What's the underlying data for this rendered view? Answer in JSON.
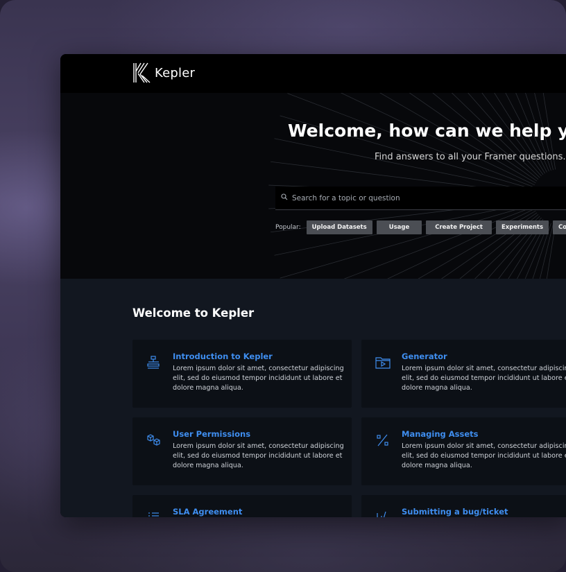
{
  "app": {
    "brand": "Kepler"
  },
  "hero": {
    "title": "Welcome, how can we help you",
    "subtitle": "Find answers to all your Framer questions.",
    "search_placeholder": "Search for a topic or question",
    "popular_label": "Popular:",
    "chips": [
      "Upload Datasets",
      "Usage",
      "Create Project",
      "Experiments",
      "Connect"
    ]
  },
  "main": {
    "section_title": "Welcome to Kepler",
    "cards": [
      {
        "title": "Introduction to Kepler",
        "desc": "Lorem ipsum dolor sit amet, consectetur adipiscing elit, sed do eiusmod tempor incididunt ut labore et dolore magna aliqua.",
        "icon": "hierarchy-icon"
      },
      {
        "title": "Generator",
        "desc": "Lorem ipsum dolor sit amet, consectetur adipiscing elit, sed do eiusmod tempor incididunt ut labore et dolore magna aliqua.",
        "icon": "folder-play-icon"
      },
      {
        "title": "User Permissions",
        "desc": "Lorem ipsum dolor sit amet, consectetur adipiscing elit, sed do eiusmod tempor incididunt ut labore et dolore magna aliqua.",
        "icon": "cubes-icon"
      },
      {
        "title": "Managing Assets",
        "desc": "Lorem ipsum dolor sit amet, consectetur adipiscing elit, sed do eiusmod tempor incididunt ut labore et dolore magna aliqua.",
        "icon": "percent-icon"
      },
      {
        "title": "SLA Agreement",
        "desc": "",
        "icon": "list-icon"
      },
      {
        "title": "Submitting a bug/ticket",
        "desc": "",
        "icon": "chart-icon"
      }
    ]
  },
  "colors": {
    "accent": "#3f8ef0",
    "chip_bg": "#4b4e54",
    "content_bg": "#121720",
    "card_bg": "#0c1016"
  }
}
